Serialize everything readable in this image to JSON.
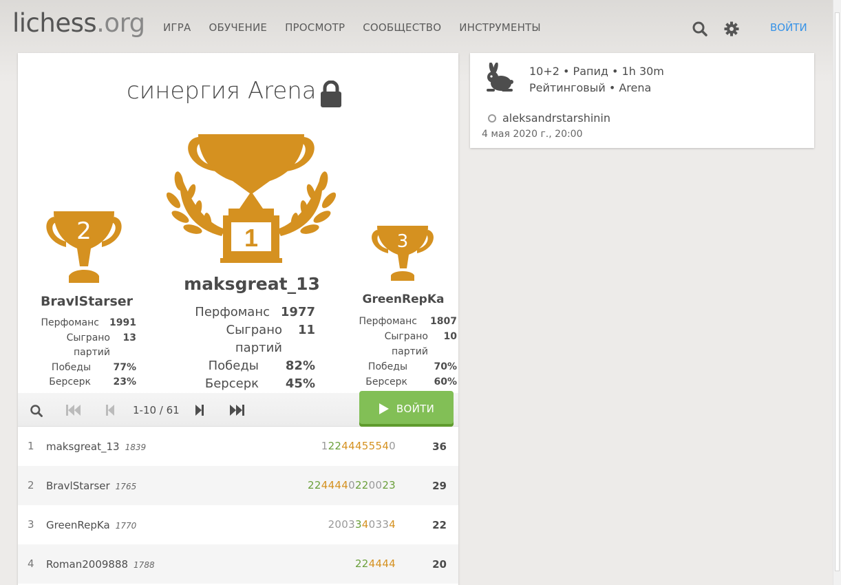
{
  "header": {
    "logo_main": "lichess",
    "logo_tld": ".org",
    "nav": [
      "ИГРА",
      "ОБУЧЕНИЕ",
      "ПРОСМОТР",
      "СООБЩЕСТВО",
      "ИНСТРУМЕНТЫ"
    ],
    "login": "ВОЙТИ"
  },
  "tournament": {
    "title": "синергия Arena"
  },
  "podium": {
    "first": {
      "rank": "1",
      "name": "maksgreat_13",
      "perf_label": "Перфоманс",
      "perf": "1977",
      "games_label": "Сыграно партий",
      "games": "11",
      "wins_label": "Победы",
      "wins": "82%",
      "berserk_label": "Берсерк",
      "berserk": "45%"
    },
    "second": {
      "rank": "2",
      "name": "BravlStarser",
      "perf_label": "Перфоманс",
      "perf": "1991",
      "games_label": "Сыграно партий",
      "games": "13",
      "wins_label": "Победы",
      "wins": "77%",
      "berserk_label": "Берсерк",
      "berserk": "23%"
    },
    "third": {
      "rank": "3",
      "name": "GreenRepKa",
      "perf_label": "Перфоманс",
      "perf": "1807",
      "games_label": "Сыграно партий",
      "games": "10",
      "wins_label": "Победы",
      "wins": "70%",
      "berserk_label": "Берсерк",
      "berserk": "60%"
    }
  },
  "pager": {
    "range": "1-10 / 61",
    "join": "ВОЙТИ"
  },
  "standings": [
    {
      "rank": "1",
      "name": "maksgreat_13",
      "rating": "1839",
      "sheet": [
        [
          "1",
          "gray"
        ],
        [
          "2",
          "green"
        ],
        [
          "2",
          "green"
        ],
        [
          "4",
          "orange"
        ],
        [
          "4",
          "orange"
        ],
        [
          "4",
          "orange"
        ],
        [
          "5",
          "orange"
        ],
        [
          "5",
          "orange"
        ],
        [
          "5",
          "orange"
        ],
        [
          "4",
          "orange"
        ],
        [
          "0",
          "gray"
        ]
      ],
      "total": "36"
    },
    {
      "rank": "2",
      "name": "BravlStarser",
      "rating": "1765",
      "sheet": [
        [
          "2",
          "green"
        ],
        [
          "2",
          "green"
        ],
        [
          "4",
          "orange"
        ],
        [
          "4",
          "orange"
        ],
        [
          "4",
          "orange"
        ],
        [
          "4",
          "orange"
        ],
        [
          "0",
          "gray"
        ],
        [
          "2",
          "green"
        ],
        [
          "2",
          "green"
        ],
        [
          "0",
          "gray"
        ],
        [
          "0",
          "gray"
        ],
        [
          "2",
          "green"
        ],
        [
          "3",
          "green"
        ]
      ],
      "total": "29"
    },
    {
      "rank": "3",
      "name": "GreenRepKa",
      "rating": "1770",
      "sheet": [
        [
          "2",
          "gray"
        ],
        [
          "0",
          "gray"
        ],
        [
          "0",
          "gray"
        ],
        [
          "3",
          "gray"
        ],
        [
          "3",
          "green"
        ],
        [
          "4",
          "orange"
        ],
        [
          "0",
          "gray"
        ],
        [
          "3",
          "gray"
        ],
        [
          "3",
          "gray"
        ],
        [
          "4",
          "orange"
        ]
      ],
      "total": "22"
    },
    {
      "rank": "4",
      "name": "Roman2009888",
      "rating": "1788",
      "sheet": [
        [
          "2",
          "green"
        ],
        [
          "2",
          "green"
        ],
        [
          "4",
          "orange"
        ],
        [
          "4",
          "orange"
        ],
        [
          "4",
          "orange"
        ],
        [
          "4",
          "orange"
        ]
      ],
      "total": "20"
    }
  ],
  "side": {
    "line1": "10+2 • Рапид • 1h 30m",
    "line2": "Рейтинговый • Arena",
    "creator": "aleksandrstarshinin",
    "date": "4 мая 2020 г., 20:00"
  },
  "colors": {
    "gold": "#d59120",
    "green": "#6a9f3a",
    "join": "#82bf56",
    "link": "#3692e7"
  }
}
